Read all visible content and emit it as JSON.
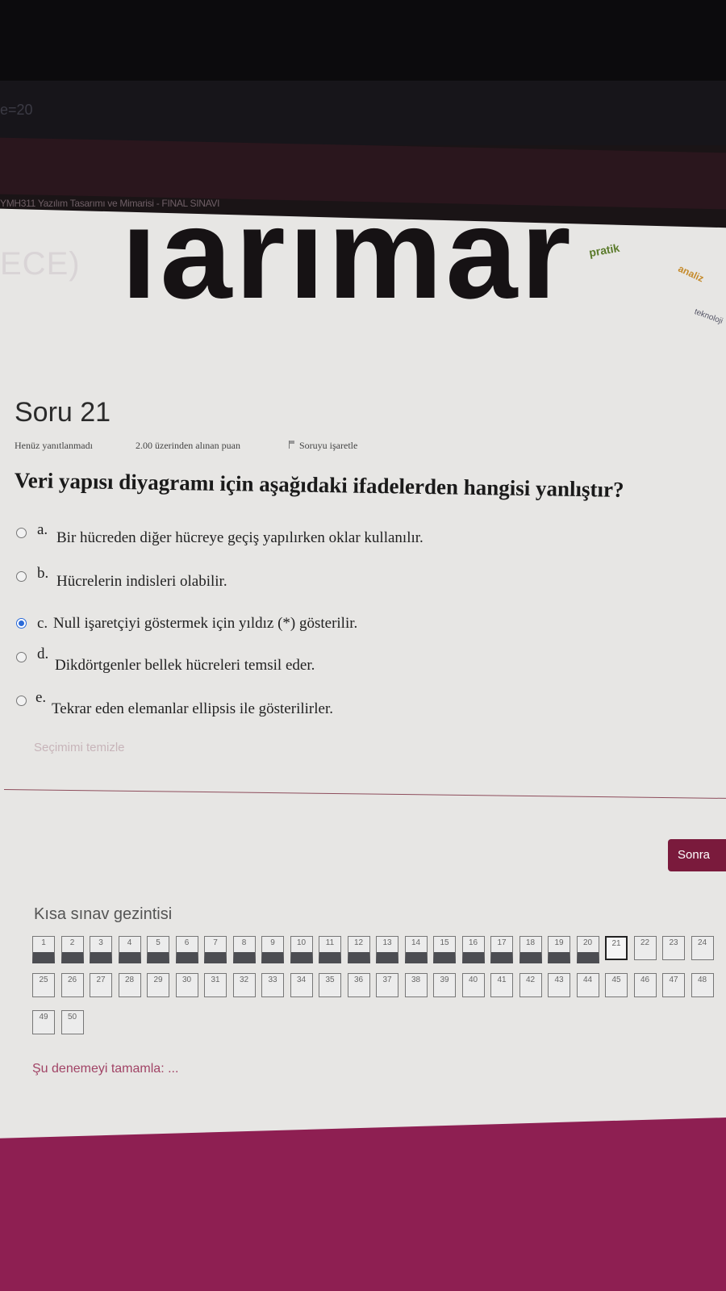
{
  "browser": {
    "url_fragment": "e=20"
  },
  "course": {
    "breadcrumb": "YMH311 Yazılım Tasarımı ve Mimarisi - FINAL SINAVI",
    "badge": "ECE)",
    "banner_word": "ıarımar",
    "banner_tags": [
      "pratik",
      "analiz",
      "teknoloji"
    ]
  },
  "question": {
    "title": "Soru 21",
    "status": "Henüz yanıtlanmadı",
    "points": "2.00 üzerinden alınan puan",
    "flag_label": "Soruyu işaretle",
    "text": "Veri yapısı diyagramı için aşağıdaki ifadelerden hangisi yanlıştır?",
    "options": [
      {
        "letter": "a.",
        "text": "Bir hücreden diğer hücreye geçiş yapılırken oklar kullanılır.",
        "selected": false
      },
      {
        "letter": "b.",
        "text": "Hücrelerin indisleri olabilir.",
        "selected": false
      },
      {
        "letter": "c.",
        "text": "Null işaretçiyi göstermek için yıldız (*) gösterilir.",
        "selected": true
      },
      {
        "letter": "d.",
        "text": "Dikdörtgenler bellek hücreleri temsil eder.",
        "selected": false
      },
      {
        "letter": "e.",
        "text": "Tekrar eden elemanlar ellipsis ile gösterilirler.",
        "selected": false
      }
    ],
    "clear_label": "Seçimimi temizle"
  },
  "navigation": {
    "next_label": "Sonra",
    "title": "Kısa sınav gezintisi",
    "current": 21,
    "answered": [
      1,
      2,
      3,
      4,
      5,
      6,
      7,
      8,
      9,
      10,
      11,
      12,
      13,
      14,
      15,
      16,
      17,
      18,
      19,
      20
    ],
    "total": 50,
    "finish_label": "Şu denemeyi tamamla: ..."
  },
  "colors": {
    "accent": "#7a1a3c",
    "footer": "#8e1f52",
    "radio_selected": "#2a6ad8"
  }
}
